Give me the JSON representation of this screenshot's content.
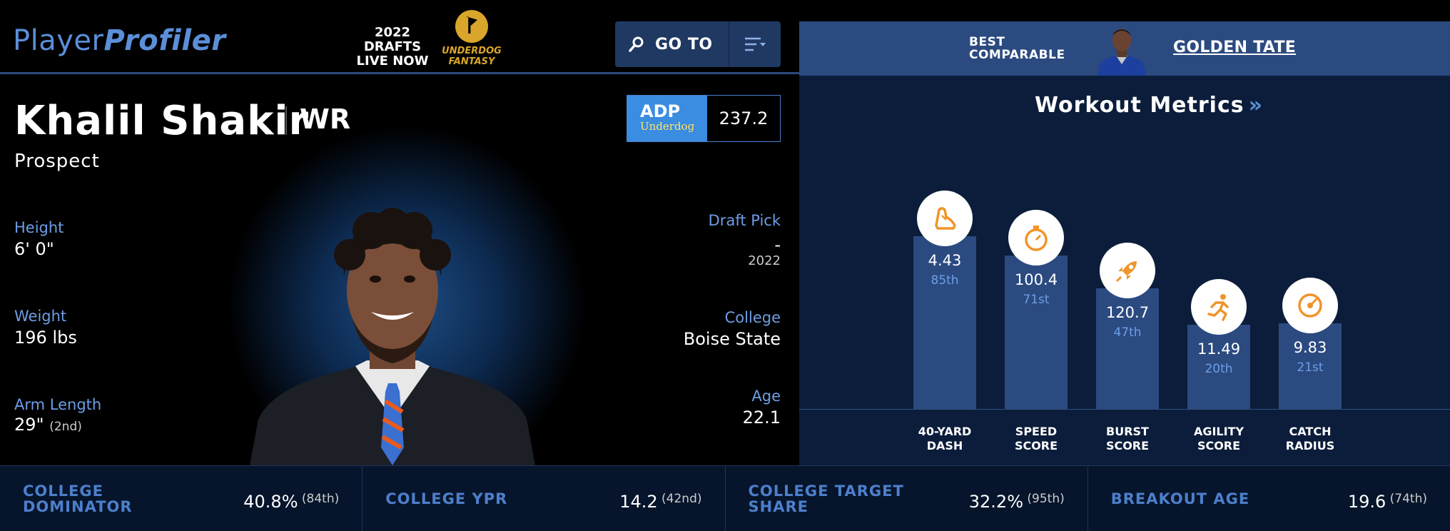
{
  "header": {
    "logo_part1": "Player",
    "logo_part2": "Profiler",
    "drafts_line1": "2022 DRAFTS",
    "drafts_line2": "LIVE NOW",
    "partner_line1": "UNDERDOG",
    "partner_line2": "FANTASY",
    "goto_label": "GO TO"
  },
  "comparable": {
    "label_line1": "BEST",
    "label_line2": "COMPARABLE",
    "name": "GOLDEN TATE"
  },
  "player": {
    "name": "Khalil Shakir",
    "position": "WR",
    "status": "Prospect",
    "adp_label": "ADP",
    "adp_source": "Underdog",
    "adp_value": "237.2",
    "height_label": "Height",
    "height_value": "6' 0\"",
    "weight_label": "Weight",
    "weight_value": "196 lbs",
    "arm_label": "Arm Length",
    "arm_value": "29\"",
    "arm_rank": "(2nd)",
    "draft_pick_label": "Draft Pick",
    "draft_pick_value": "-",
    "draft_year": "2022",
    "college_label": "College",
    "college_value": "Boise State",
    "age_label": "Age",
    "age_value": "22.1"
  },
  "workout": {
    "title": "Workout Metrics",
    "chevron": "»",
    "metrics": [
      {
        "label_line1": "40-YARD",
        "label_line2": "DASH",
        "value": "4.43",
        "percentile": "85th",
        "pct_num": 85,
        "icon": "shoe-icon"
      },
      {
        "label_line1": "SPEED",
        "label_line2": "SCORE",
        "value": "100.4",
        "percentile": "71st",
        "pct_num": 71,
        "icon": "stopwatch-icon"
      },
      {
        "label_line1": "BURST",
        "label_line2": "SCORE",
        "value": "120.7",
        "percentile": "47th",
        "pct_num": 47,
        "icon": "rocket-icon"
      },
      {
        "label_line1": "AGILITY",
        "label_line2": "SCORE",
        "value": "11.49",
        "percentile": "20th",
        "pct_num": 20,
        "icon": "runner-icon"
      },
      {
        "label_line1": "CATCH",
        "label_line2": "RADIUS",
        "value": "9.83",
        "percentile": "21st",
        "pct_num": 21,
        "icon": "target-icon"
      }
    ]
  },
  "bottom_stats": [
    {
      "label": "COLLEGE DOMINATOR",
      "value": "40.8%",
      "rank": "(84th)"
    },
    {
      "label": "COLLEGE YPR",
      "value": "14.2",
      "rank": "(42nd)"
    },
    {
      "label": "COLLEGE TARGET SHARE",
      "value": "32.2%",
      "rank": "(95th)"
    },
    {
      "label": "BREAKOUT AGE",
      "value": "19.6",
      "rank": "(74th)"
    }
  ],
  "colors": {
    "accent_blue": "#5b8fd8",
    "icon_orange": "#f0952a",
    "bar_blue": "#2b4a80",
    "partner_gold": "#d9a52b"
  }
}
